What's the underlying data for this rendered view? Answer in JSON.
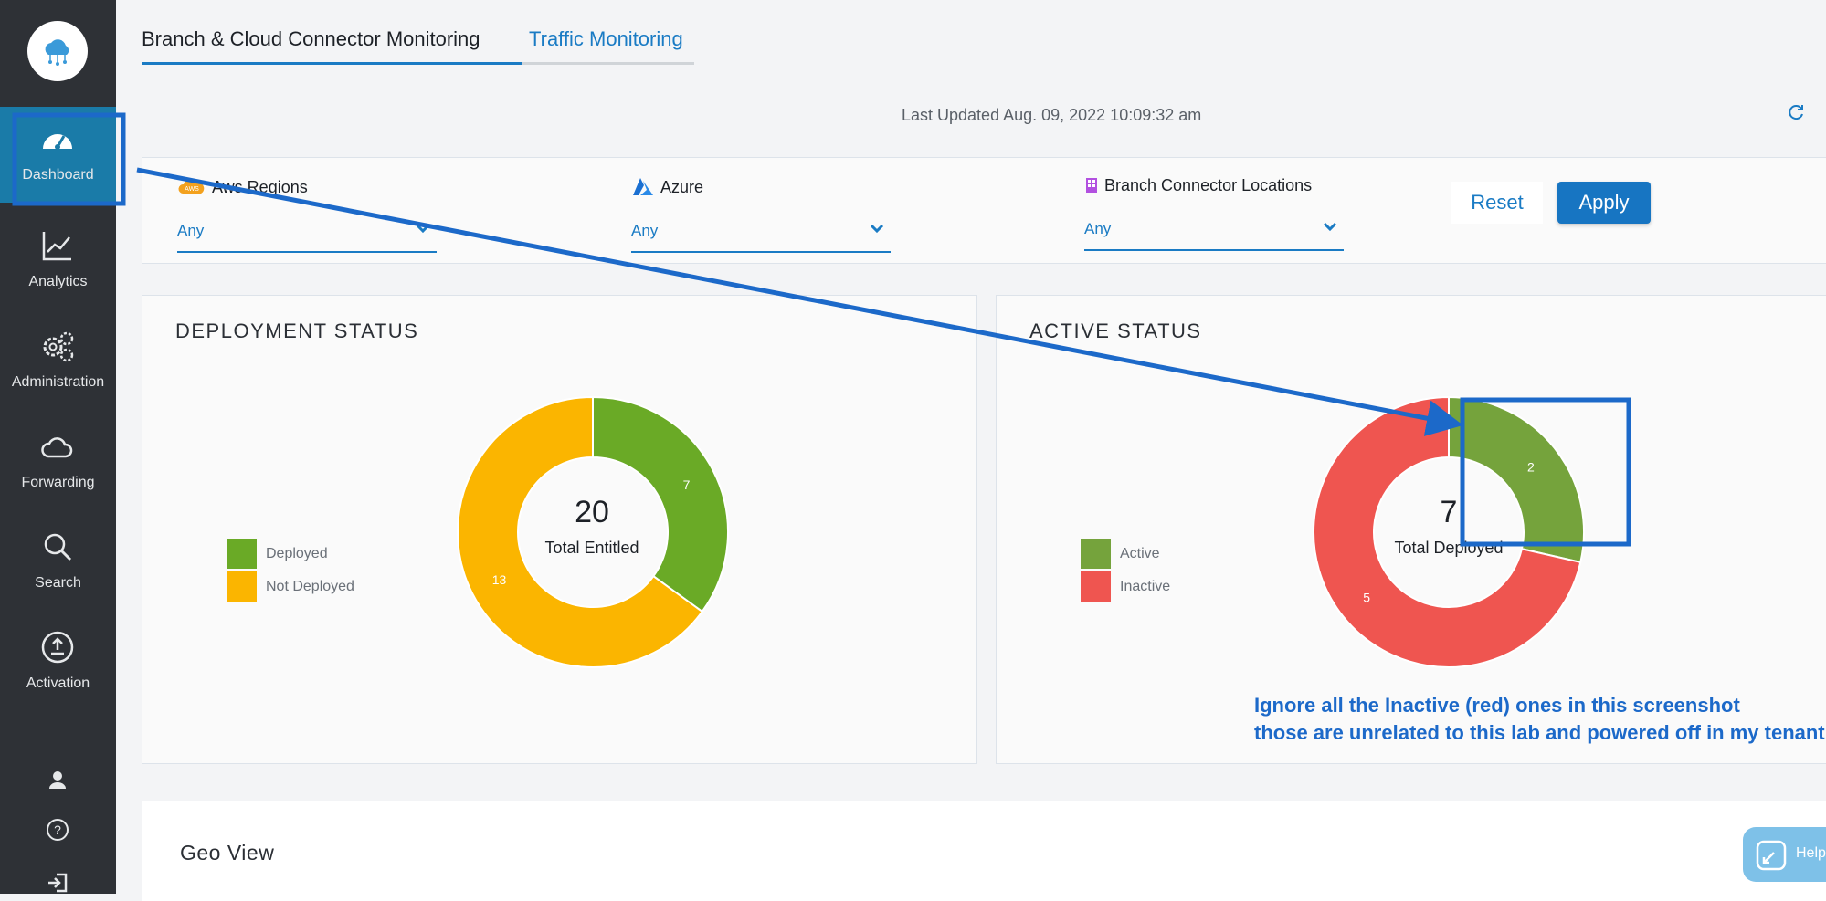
{
  "sidebar": {
    "items": [
      {
        "label": "Dashboard",
        "icon": "speedometer-icon"
      },
      {
        "label": "Analytics",
        "icon": "chart-line-icon"
      },
      {
        "label": "Administration",
        "icon": "gears-icon"
      },
      {
        "label": "Forwarding",
        "icon": "cloud-icon"
      },
      {
        "label": "Search",
        "icon": "search-icon"
      },
      {
        "label": "Activation",
        "icon": "upload-icon"
      }
    ],
    "active_color": "#1a7ba8"
  },
  "tabs": [
    {
      "label": "Branch & Cloud Connector Monitoring"
    },
    {
      "label": "Traffic Monitoring"
    }
  ],
  "last_updated": "Last Updated Aug. 09, 2022 10:09:32 am",
  "filters": [
    {
      "label": "Aws Regions",
      "value": "Any",
      "icon": "aws-icon"
    },
    {
      "label": "Azure",
      "value": "Any",
      "icon": "azure-icon"
    },
    {
      "label": "Branch Connector Locations",
      "value": "Any",
      "icon": "building-icon"
    }
  ],
  "buttons": {
    "reset": "Reset",
    "apply": "Apply"
  },
  "deployment": {
    "title": "DEPLOYMENT STATUS",
    "center_value": "20",
    "center_label": "Total Entitled"
  },
  "active": {
    "title": "ACTIVE STATUS",
    "center_value": "7",
    "center_label": "Total Deployed"
  },
  "chart_data": [
    {
      "type": "pie",
      "title": "DEPLOYMENT STATUS",
      "categories": [
        "Deployed",
        "Not Deployed"
      ],
      "values": [
        7,
        13
      ],
      "colors": [
        "#6aaa26",
        "#fbb500"
      ],
      "legend_position": "left"
    },
    {
      "type": "pie",
      "title": "ACTIVE STATUS",
      "categories": [
        "Active",
        "Inactive"
      ],
      "values": [
        2,
        5
      ],
      "colors": [
        "#75a33c",
        "#ef5550"
      ],
      "legend_position": "left"
    }
  ],
  "geo_view": {
    "title": "Geo View"
  },
  "annotation": {
    "line1": "Ignore all the Inactive (red) ones in this screenshot",
    "line2": "those are unrelated to this lab and powered off in my tenant",
    "color": "#1c69c9"
  },
  "help": {
    "label": "Help"
  }
}
